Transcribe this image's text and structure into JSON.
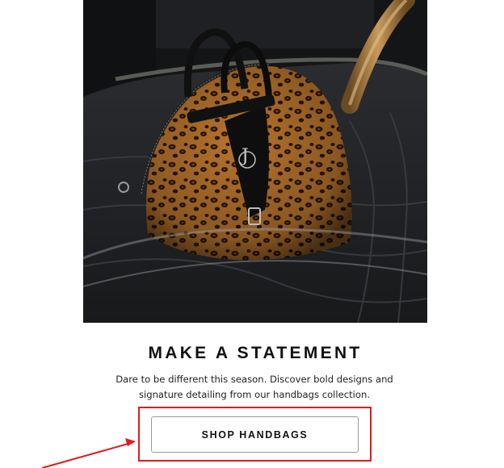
{
  "hero": {
    "alt": "Leopard-print handbag on a car seat"
  },
  "content": {
    "headline": "MAKE A STATEMENT",
    "body_line1": "Dare to be different this season. Discover bold designs and",
    "body_line2": "signature detailing from our handbags collection."
  },
  "cta": {
    "label": "SHOP HANDBAGS"
  },
  "annotation": {
    "color": "#e01b1b"
  }
}
